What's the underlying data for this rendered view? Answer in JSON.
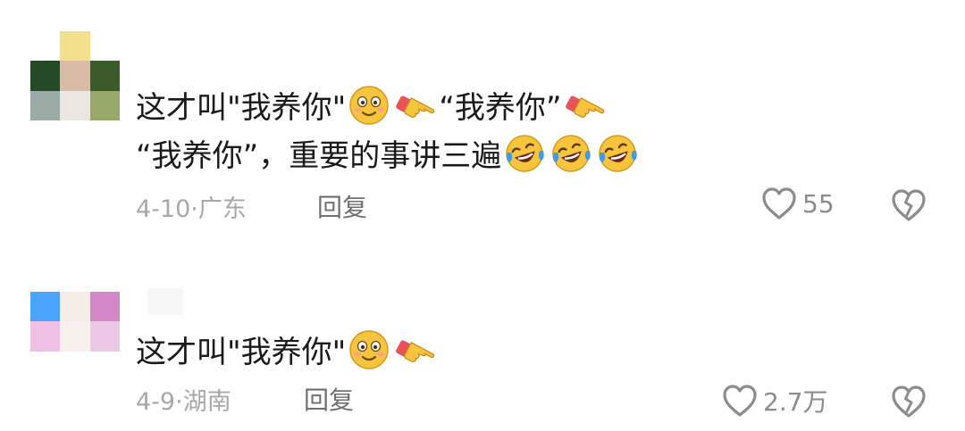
{
  "comments": [
    {
      "avatar_colors": [
        "#ffffff",
        "#f2e08a",
        "#ffffff",
        "#254a26",
        "#d9bba8",
        "#3a5a2a",
        "#9aaaa5",
        "#ece6e2",
        "#98a868"
      ],
      "username": "",
      "segments": [
        {
          "type": "text",
          "value": "这才叫\"我养你\""
        },
        {
          "type": "emoji",
          "icon": "blushing-smile-icon"
        },
        {
          "type": "emoji",
          "icon": "pointing-hand-icon"
        },
        {
          "type": "text",
          "value": "“我养你”"
        },
        {
          "type": "emoji",
          "icon": "pointing-hand-icon"
        },
        {
          "type": "text",
          "value": "“我养你”，重要的事讲三遍"
        },
        {
          "type": "emoji",
          "icon": "laughing-tears-icon"
        },
        {
          "type": "emoji",
          "icon": "laughing-tears-icon"
        },
        {
          "type": "emoji",
          "icon": "laughing-tears-icon"
        }
      ],
      "date": "4-10",
      "location": "广东",
      "reply_label": "回复",
      "likes": "55"
    },
    {
      "avatar_colors": [
        "#4aa3ff",
        "#f6ede6",
        "#d487c6",
        "#f0c0e6",
        "#f7f0ec",
        "#ecc8e6",
        "#ffffff",
        "#ffffff",
        "#ffffff"
      ],
      "username": "",
      "segments": [
        {
          "type": "text",
          "value": "这才叫\"我养你\""
        },
        {
          "type": "emoji",
          "icon": "blushing-smile-icon"
        },
        {
          "type": "emoji",
          "icon": "pointing-hand-icon"
        }
      ],
      "date": "4-9",
      "location": "湖南",
      "reply_label": "回复",
      "likes": "2.7万"
    }
  ],
  "meta_separator": "·",
  "colors": {
    "text": "#1a1a1a",
    "meta": "#a8a8a8",
    "reply": "#6f6f6f",
    "icon": "#8c8c8c",
    "emoji_face": "#f7c53d",
    "hand_sleeve": "#e8535a"
  }
}
